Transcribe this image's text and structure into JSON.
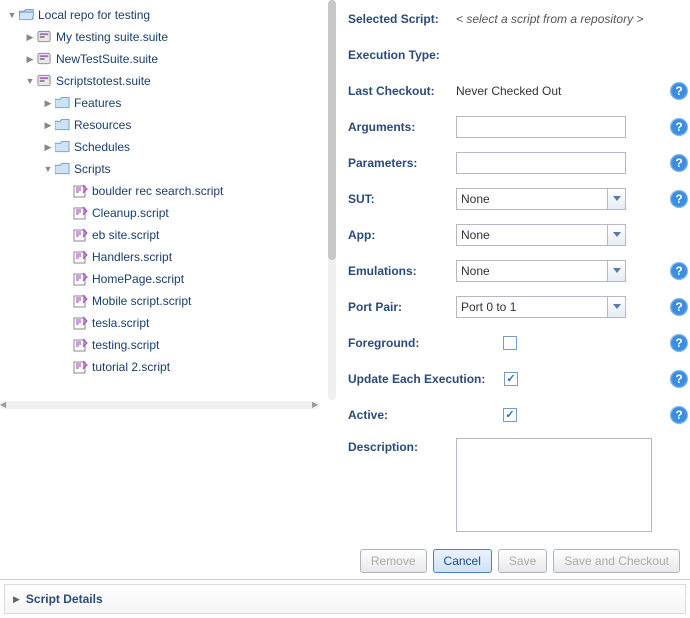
{
  "tree": {
    "root": "Local repo for testing",
    "suite1": "My testing suite.suite",
    "suite2": "NewTestSuite.suite",
    "suite3": "Scriptstotest.suite",
    "folder_features": "Features",
    "folder_resources": "Resources",
    "folder_schedules": "Schedules",
    "folder_scripts": "Scripts",
    "scripts": [
      "boulder rec search.script",
      "Cleanup.script",
      "eb site.script",
      "Handlers.script",
      "HomePage.script",
      "Mobile script.script",
      "tesla.script",
      "testing.script",
      "tutorial 2.script"
    ]
  },
  "form": {
    "selectedScriptLabel": "Selected Script:",
    "selectedScriptValue": "< select a script from a repository >",
    "executionTypeLabel": "Execution Type:",
    "lastCheckoutLabel": "Last Checkout:",
    "lastCheckoutValue": "Never Checked Out",
    "argumentsLabel": "Arguments:",
    "argumentsValue": "",
    "parametersLabel": "Parameters:",
    "parametersValue": "",
    "sutLabel": "SUT:",
    "sutValue": "None",
    "appLabel": "App:",
    "appValue": "None",
    "emulationsLabel": "Emulations:",
    "emulationsValue": "None",
    "portPairLabel": "Port Pair:",
    "portPairValue": "Port 0 to 1",
    "foregroundLabel": "Foreground:",
    "updateEachLabel": "Update Each Execution:",
    "activeLabel": "Active:",
    "descriptionLabel": "Description:",
    "descriptionValue": ""
  },
  "buttons": {
    "remove": "Remove",
    "cancel": "Cancel",
    "save": "Save",
    "saveCheckout": "Save and Checkout"
  },
  "details": {
    "label": "Script Details"
  }
}
